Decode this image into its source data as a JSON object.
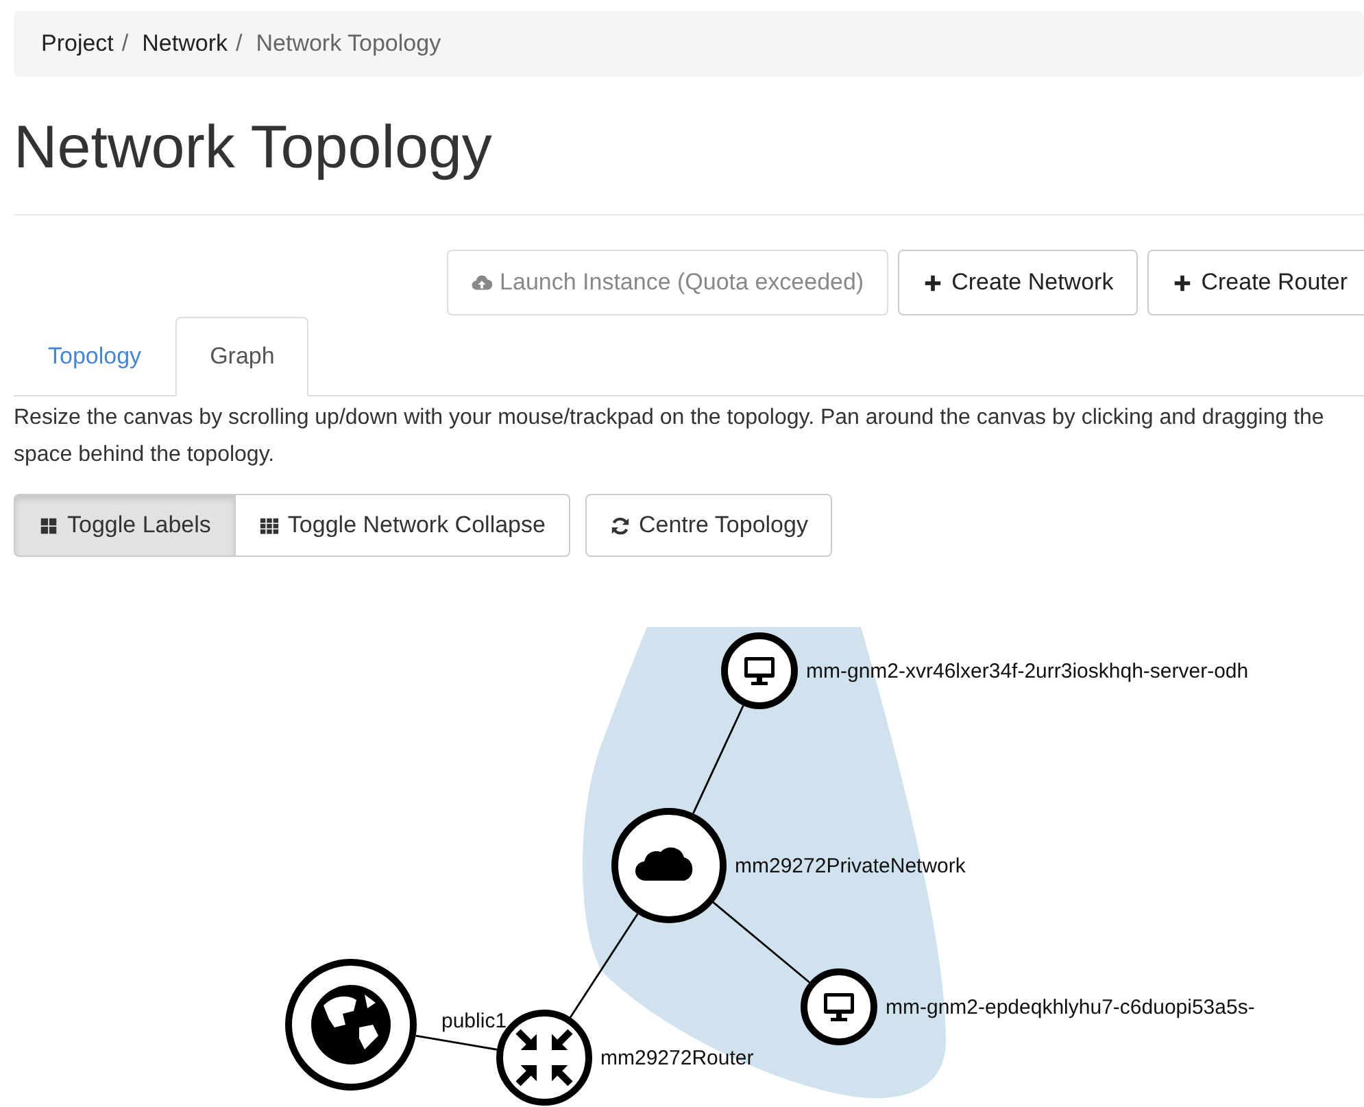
{
  "breadcrumb": [
    {
      "label": "Project",
      "current": false,
      "separator": "/"
    },
    {
      "label": "Network",
      "current": false,
      "separator": "/"
    },
    {
      "label": "Network Topology",
      "current": true
    }
  ],
  "title": "Network Topology",
  "actions": [
    {
      "label": "Launch Instance (Quota exceeded)",
      "kind": "launch",
      "disabled": true
    },
    {
      "label": "Create Network",
      "kind": "create",
      "disabled": false
    },
    {
      "label": "Create Router",
      "kind": "create",
      "disabled": false
    }
  ],
  "tabs": [
    {
      "label": "Topology",
      "selected": false
    },
    {
      "label": "Graph",
      "selected": true
    }
  ],
  "help": "Resize the canvas by scrolling up/down with your mouse/trackpad on the topology. Pan around the canvas by clicking and dragging the space behind the topology.",
  "toggles": [
    {
      "label": "Toggle Labels",
      "kind": "labels",
      "active": true
    },
    {
      "label": "Toggle Network Collapse",
      "kind": "collapse",
      "active": false
    }
  ],
  "centre_button": "Centre Topology",
  "graph": {
    "nodes": [
      {
        "kind": "instance",
        "label": "mm-gnm2-xvr46lxer34f-2urr3ioskhqh-server-odh"
      },
      {
        "kind": "network",
        "label": "mm29272PrivateNetwork"
      },
      {
        "kind": "instance",
        "label": "mm-gnm2-epdeqkhlyhu7-c6duopi53a5s-"
      },
      {
        "kind": "external",
        "label": "public1"
      },
      {
        "kind": "router",
        "label": "mm29272Router"
      }
    ]
  }
}
